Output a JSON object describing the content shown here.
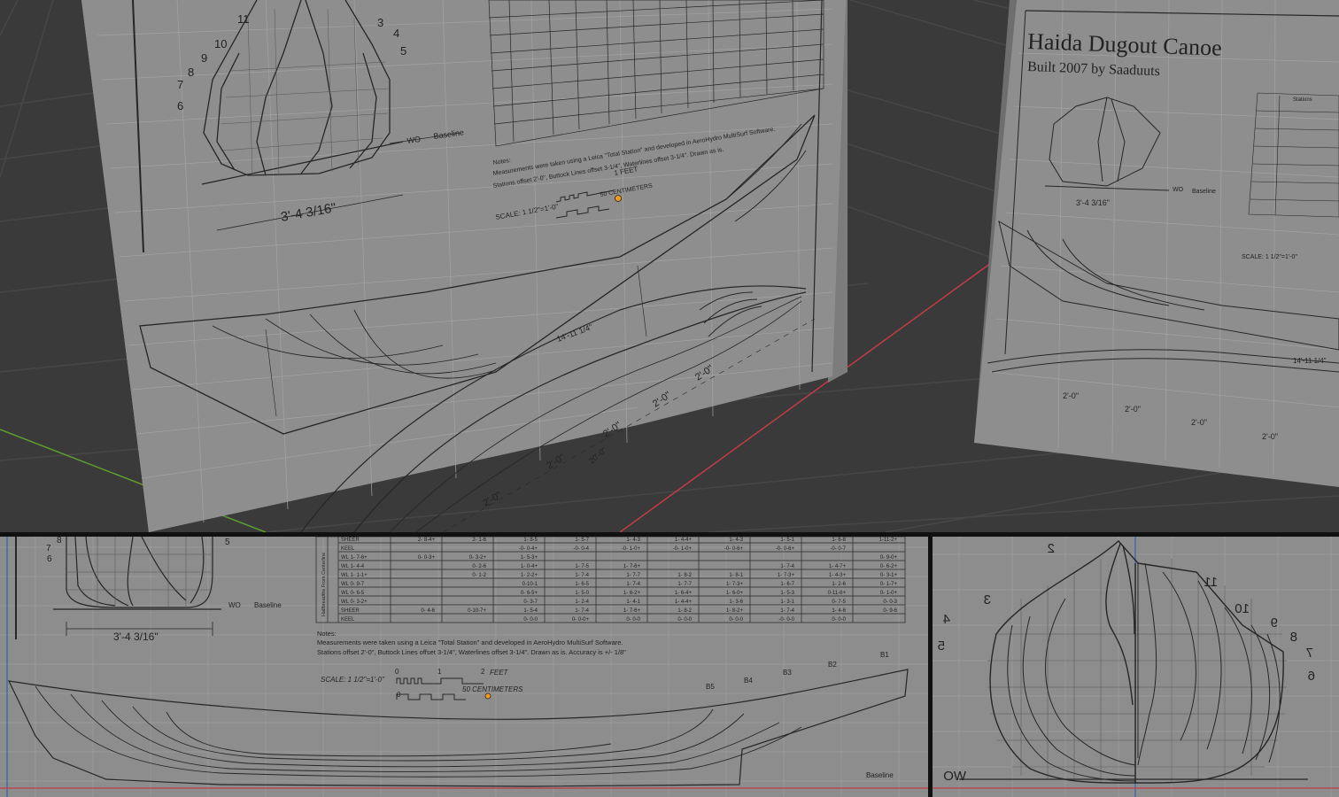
{
  "viewports": {
    "perspective": {
      "left_sheet": {
        "station_numbers": [
          "11",
          "10",
          "9",
          "8",
          "7",
          "6",
          "3",
          "4",
          "5"
        ],
        "wo_label": "WO",
        "baseline_label": "Baseline",
        "beam_dim": "3'-4 3/16\"",
        "length_dim": "14'-11 1/4\"",
        "spacing_dims": [
          "2'-0\"",
          "2'-0\"",
          "2'-0\"",
          "2'-0\"",
          "2'-0\""
        ],
        "offset_dim": "20'-0\"",
        "scale_label": "SCALE: 1 1/2\"=1'-0\"",
        "scale_feet": "1 FEET",
        "scale_cm": "50 CENTIMETERS"
      },
      "right_sheet": {
        "title": "Haida Dugout Canoe",
        "subtitle": "Built 2007 by Saaduuts",
        "beam_dim": "3'-4 3/16\"",
        "wo_label": "WO",
        "baseline_label": "Baseline",
        "stations_label": "Stations",
        "length_dim": "14'-11 1/4\"",
        "spacing_dims": [
          "2'-0\"",
          "2'-0\"",
          "2'-0\"",
          "2'-0\""
        ],
        "scale_label": "SCALE: 1 1/2\"=1'-0\""
      }
    },
    "side": {
      "station_numbers": [
        "8",
        "7",
        "6",
        "5"
      ],
      "wo_label": "WO",
      "baseline_label": "Baseline",
      "beam_dim": "3'-4 3/16\"",
      "group_label": "Halfbreadths From Centerline",
      "table_rows": [
        {
          "label": "SHEER",
          "cells": [
            "2- 8-4+",
            "2- 1-6",
            "1- 8-5",
            "1- 5-7",
            "1- 4-3",
            "1- 4-4+",
            "1- 4-3",
            "1- 5-1",
            "1- 6-8",
            "1-11-2+"
          ]
        },
        {
          "label": "KEEL",
          "cells": [
            "",
            "",
            "-0- 0-4+",
            "-0- 0-4",
            "-0- 1-0+",
            "-0- 1-0+",
            "-0- 0-6+",
            "-0- 0-6+",
            "-0- 0-7",
            ""
          ]
        },
        {
          "label": "WL 1- 7-6+",
          "cells": [
            "0- 0-3+",
            "0- 3-2+",
            "1- 5-3+",
            "",
            "",
            "",
            "",
            "",
            "",
            "0- 9-0+"
          ]
        },
        {
          "label": "WL 1- 4-4",
          "cells": [
            "",
            "0- 2-6",
            "1- 0-4+",
            "1- 7-5",
            "1- 7-6+",
            "",
            "",
            "1- 7-4",
            "1- 4-7+",
            "0- 6-2+"
          ]
        },
        {
          "label": "WL 1- 1-1+",
          "cells": [
            "",
            "0- 1-2",
            "1- 2-2+",
            "1- 7-4",
            "1- 7-7",
            "1- 8-2",
            "1- 8-1",
            "1- 7-3+",
            "1- 4-3+",
            "0- 3-1+"
          ]
        },
        {
          "label": "WL 0- 9-7",
          "cells": [
            "",
            "",
            "0-10-1",
            "1- 6-5",
            "1- 7-4",
            "1- 7-7",
            "1- 7-3+",
            "1- 6-7",
            "1- 2-6",
            "0- 1-7+"
          ]
        },
        {
          "label": "WL 0- 6-5",
          "cells": [
            "",
            "",
            "0- 6-5+",
            "1- 5-0",
            "1- 6-2+",
            "1- 6-4+",
            "1- 6-0+",
            "1- 5-3",
            "0-11-6+",
            "0- 1-0+"
          ]
        },
        {
          "label": "WL 0- 3-2+",
          "cells": [
            "",
            "",
            "0- 3-7",
            "1- 2-4",
            "1- 4-1",
            "1- 4-4+",
            "1- 3-6",
            "1- 3-1",
            "0- 7-5",
            "0- 0-3"
          ]
        },
        {
          "label": "SHEER",
          "cells": [
            "0- 4-6",
            "0-10-7+",
            "1- 5-4",
            "1- 7-4",
            "1- 7-6+",
            "1- 8-2",
            "1- 8-2+",
            "1- 7-4",
            "1- 4-6",
            "0- 9-6"
          ]
        },
        {
          "label": "KEEL",
          "cells": [
            "",
            "",
            "0- 0-0",
            "0- 0-0+",
            "0- 0-0",
            "0- 0-0",
            "0- 0-0",
            "-0- 0-0",
            "0- 0-0",
            ""
          ]
        }
      ],
      "notes_heading": "Notes:",
      "notes_line1": "Measurements were taken using a Leica \"Total Station\" and developed in AeroHydro MultiSurf Software.",
      "notes_line2": "Stations offset 2'-0\", Buttock Lines offset 3-1/4\", Waterlines offset 3-1/4\".   Drawn as is.   Accuracy is +/- 1/8\"",
      "scale_label": "SCALE:  1 1/2\"=1'-0\"",
      "scale_zero_a": "0",
      "scale_one": "1",
      "scale_two": "2",
      "scale_feet": "FEET",
      "scale_zero_b": "0",
      "scale_cm": "50  CENTIMETERS",
      "buttock_labels": [
        "B5",
        "B4",
        "B3",
        "B2",
        "B1"
      ]
    },
    "front": {
      "station_numbers": [
        "2",
        "3",
        "4",
        "5",
        "11",
        "10",
        "9",
        "8",
        "7",
        "6"
      ],
      "wo_label": "WO"
    }
  },
  "colors": {
    "viewport_background": "#3a3a3a",
    "grid_floor": "#474747",
    "sheet": "#8e8e8e",
    "ink": "#262626",
    "x_axis": "#c23b45",
    "y_axis": "#5e9e2e",
    "z_axis": "#2f63b5",
    "origin_marker": "#f29a1c",
    "divider": "#111111"
  }
}
